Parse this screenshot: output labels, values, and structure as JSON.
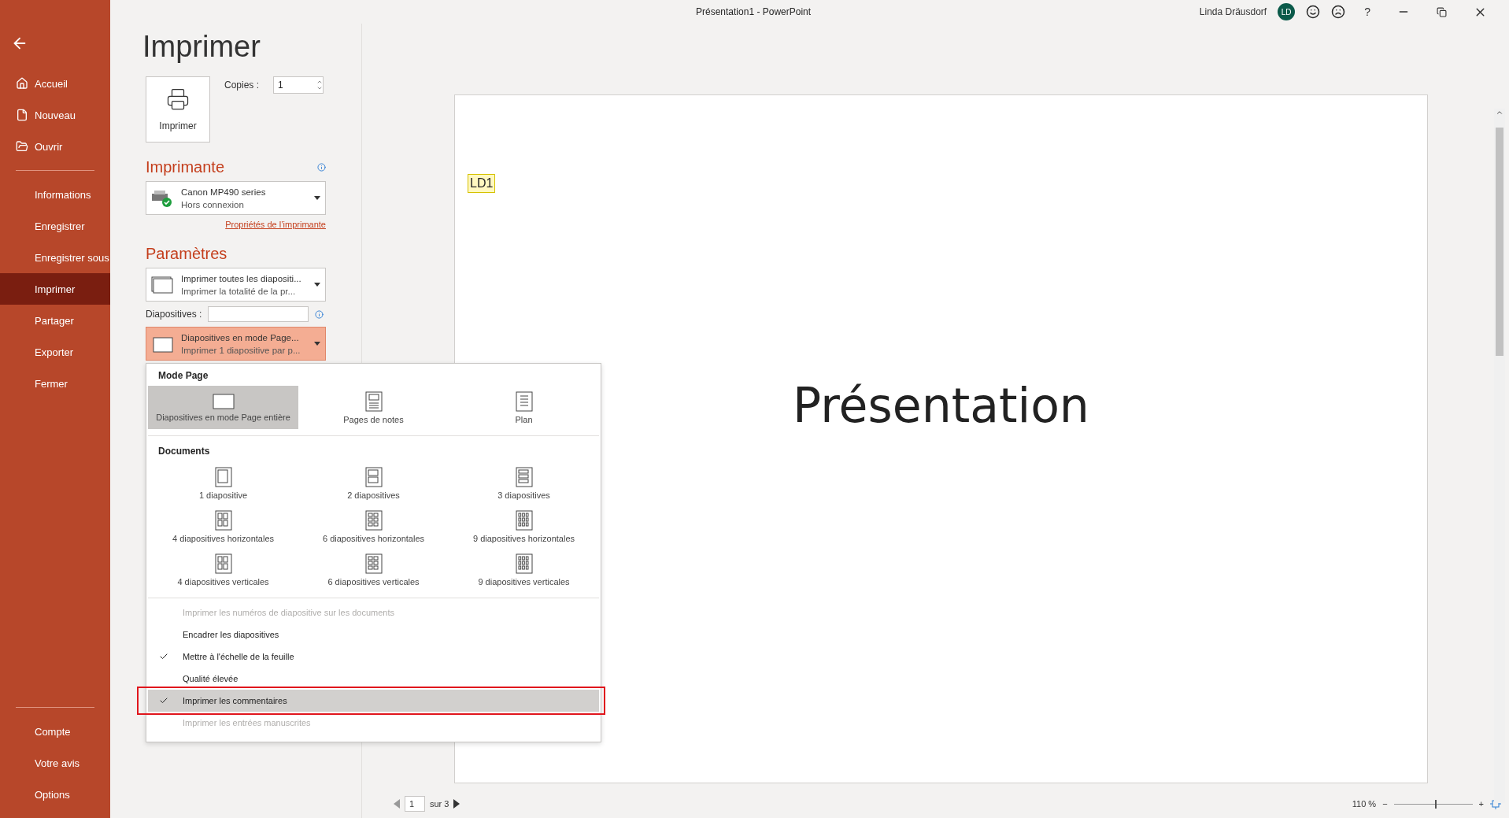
{
  "window": {
    "title": "Présentation1  -  PowerPoint",
    "user": "Linda Dräusdorf",
    "avatar": "LD",
    "help": "?"
  },
  "sidebar": {
    "groups": [
      [
        {
          "label": "Accueil",
          "selected": false
        },
        {
          "label": "Nouveau",
          "selected": false
        },
        {
          "label": "Ouvrir",
          "selected": false
        }
      ],
      [
        {
          "label": "Informations",
          "selected": false
        },
        {
          "label": "Enregistrer",
          "selected": false
        },
        {
          "label": "Enregistrer sous",
          "selected": false
        },
        {
          "label": "Imprimer",
          "selected": true
        },
        {
          "label": "Partager",
          "selected": false
        },
        {
          "label": "Exporter",
          "selected": false
        },
        {
          "label": "Fermer",
          "selected": false
        }
      ],
      [
        {
          "label": "Compte",
          "selected": false
        },
        {
          "label": "Votre avis",
          "selected": false
        },
        {
          "label": "Options",
          "selected": false
        }
      ]
    ]
  },
  "print": {
    "heading": "Imprimer",
    "button": "Imprimer",
    "copies_label": "Copies :",
    "copies": "1"
  },
  "printer": {
    "heading": "Imprimante",
    "name": "Canon MP490 series",
    "status": "Hors connexion",
    "link": "Propriétés de l’imprimante"
  },
  "settings": {
    "heading": "Paramètres",
    "dropdowns": [
      {
        "title": "Imprimer toutes les diapositi...",
        "subtitle": "Imprimer la totalité de la pr...",
        "open": false
      },
      {
        "title": "Diapositives en mode Page...",
        "subtitle": "Imprimer 1 diapositive par p...",
        "open": true
      }
    ],
    "slides_label": "Diapositives :"
  },
  "layout_menu": {
    "sections": [
      {
        "heading": "Mode Page",
        "options": [
          {
            "label": "Diapositives en mode Page entière",
            "selected": true
          },
          {
            "label": "Pages de notes",
            "selected": false
          },
          {
            "label": "Plan",
            "selected": false
          }
        ]
      },
      {
        "heading": "Documents",
        "options": [
          {
            "label": "1 diapositive",
            "selected": false
          },
          {
            "label": "2 diapositives",
            "selected": false
          },
          {
            "label": "3 diapositives",
            "selected": false
          },
          {
            "label": "4 diapositives horizontales",
            "selected": false
          },
          {
            "label": "6 diapositives horizontales",
            "selected": false
          },
          {
            "label": "9 diapositives horizontales",
            "selected": false
          },
          {
            "label": "4 diapositives verticales",
            "selected": false
          },
          {
            "label": "6 diapositives verticales",
            "selected": false
          },
          {
            "label": "9 diapositives verticales",
            "selected": false
          }
        ]
      }
    ],
    "toggles": [
      {
        "label": "Imprimer les numéros de diapositive sur les documents",
        "checked": false,
        "disabled": true,
        "highlighted": false,
        "annotated": false
      },
      {
        "label": "Encadrer les diapositives",
        "checked": false,
        "disabled": false,
        "highlighted": false,
        "annotated": false
      },
      {
        "label": "Mettre à l'échelle de la feuille",
        "checked": true,
        "disabled": false,
        "highlighted": false,
        "annotated": false
      },
      {
        "label": "Qualité élevée",
        "checked": false,
        "disabled": false,
        "highlighted": false,
        "annotated": false
      },
      {
        "label": "Imprimer les commentaires",
        "checked": true,
        "disabled": false,
        "highlighted": true,
        "annotated": true
      },
      {
        "label": "Imprimer les entrées manuscrites",
        "checked": false,
        "disabled": true,
        "highlighted": false,
        "annotated": false
      }
    ]
  },
  "preview": {
    "comment_marker": "LD1",
    "slide_title": "Présentation"
  },
  "pager": {
    "page": "1",
    "of": "sur 3",
    "zoom": "110 %",
    "zoom_minus": "−",
    "zoom_plus": "+",
    "level": 0.52
  }
}
